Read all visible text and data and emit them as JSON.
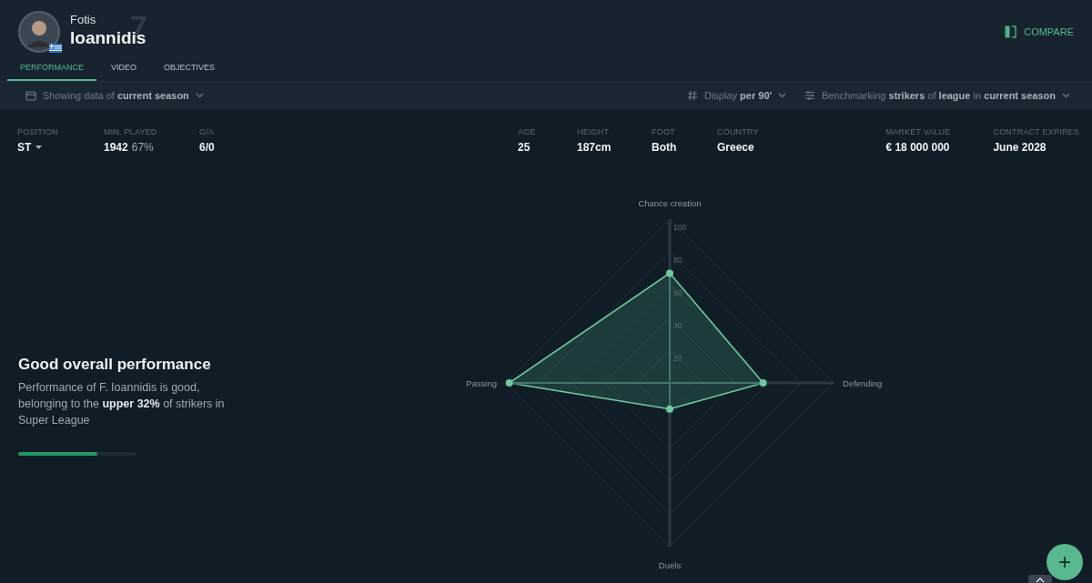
{
  "player": {
    "first_name": "Fotis",
    "last_name": "Ioannidis",
    "jersey_number": "7"
  },
  "compare_button": {
    "label": "COMPARE"
  },
  "tabs": [
    {
      "label": "PERFORMANCE",
      "selected": true
    },
    {
      "label": "VIDEO",
      "selected": false
    },
    {
      "label": "OBJECTIVES",
      "selected": false
    }
  ],
  "filters": {
    "season": "Showing data of **current season**",
    "display": "Display **per 90'**",
    "benchmark": "Benchmarking **strikers** of **league** in **current season**"
  },
  "stat_groups": [
    [
      {
        "label": "POSITION",
        "value": "ST",
        "dropdown": true
      },
      {
        "label": "MIN. PLAYED",
        "value": "1942",
        "secondary": "67%"
      },
      {
        "label": "G/A",
        "value": "6/0"
      }
    ],
    [
      {
        "label": "AGE",
        "value": "25"
      },
      {
        "label": "HEIGHT",
        "value": "187cm"
      },
      {
        "label": "FOOT",
        "value": "Both"
      },
      {
        "label": "COUNTRY",
        "value": "Greece"
      }
    ],
    [
      {
        "label": "MARKET VALUE",
        "value": "€ 18 000 000"
      },
      {
        "label": "CONTRACT EXPIRES",
        "value": "June 2028"
      }
    ]
  ],
  "summary": {
    "title": "Good overall performance",
    "text": "Performance of F. Ioannidis is good, belonging to the **upper 32%** of strikers in Super League",
    "level": 0.67
  },
  "radar": {
    "scale_labels": [
      "100",
      "80",
      "60",
      "40",
      "20"
    ],
    "axes": [
      {
        "label": "Chance creation",
        "level": 0.67
      },
      {
        "label": "Defending",
        "level": 0.57
      },
      {
        "label": "Duels",
        "level": 0.16
      },
      {
        "label": "Passing",
        "level": 0.98
      }
    ]
  },
  "fab": {
    "label": "+"
  }
}
